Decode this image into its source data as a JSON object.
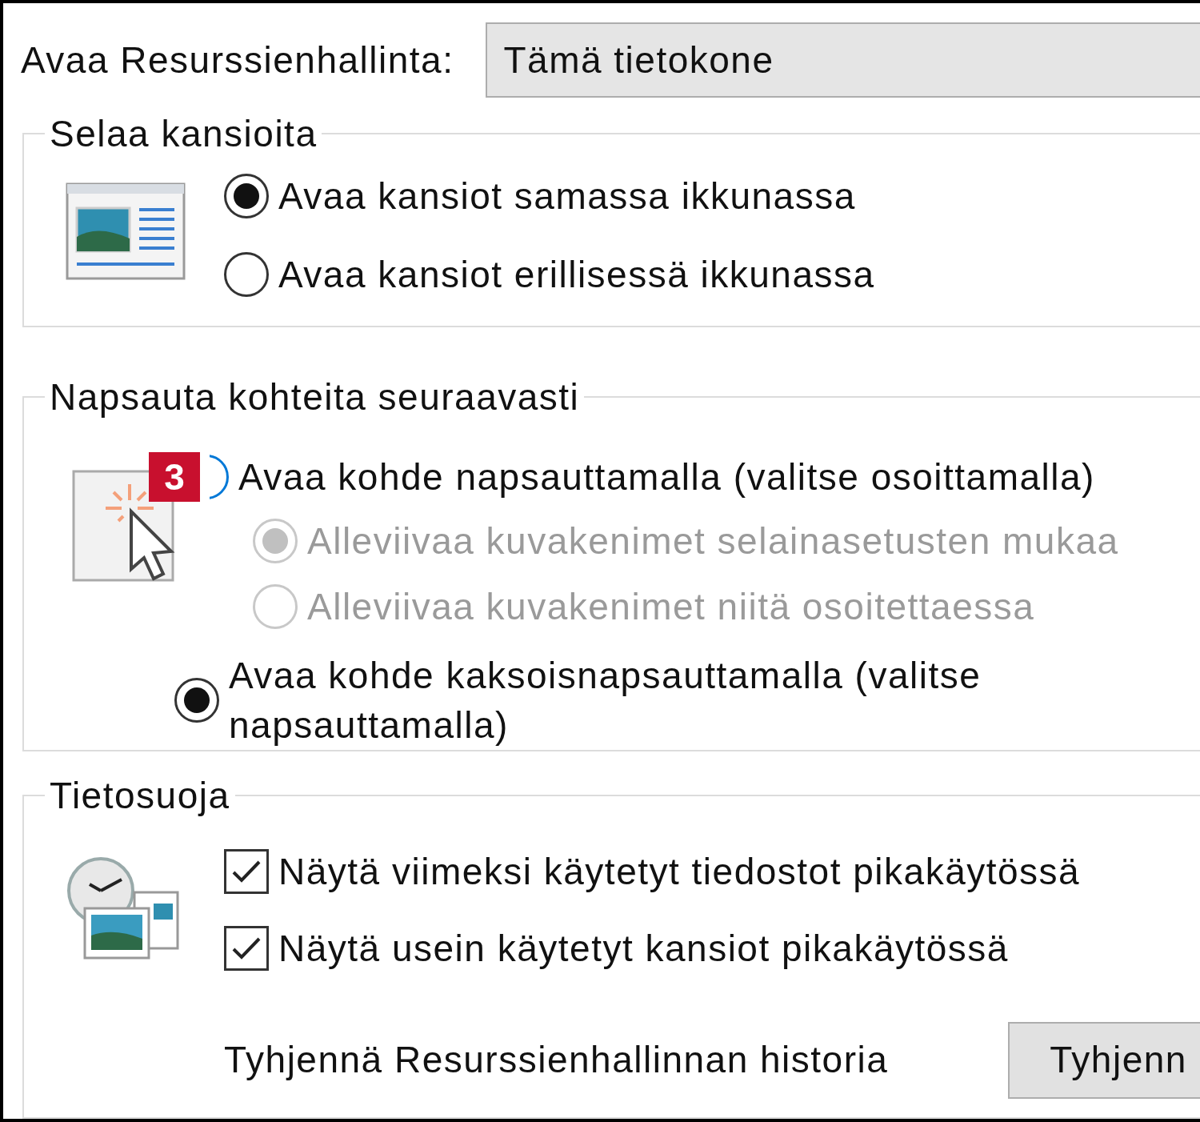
{
  "open_explorer": {
    "label": "Avaa Resurssienhallinta:",
    "value": "Tämä tietokone"
  },
  "browse_folders": {
    "title": "Selaa kansioita",
    "options": [
      {
        "label": "Avaa kansiot samassa ikkunassa",
        "selected": true
      },
      {
        "label": "Avaa kansiot erillisessä ikkunassa",
        "selected": false
      }
    ]
  },
  "click_items": {
    "title": "Napsauta kohteita seuraavasti",
    "badge": "3",
    "options": [
      {
        "label": "Avaa kohde napsauttamalla (valitse osoittamalla)",
        "selected": false,
        "focused": true,
        "children": [
          {
            "label": "Alleviivaa kuvakenimet selainasetusten mukaa",
            "selected": true,
            "disabled": true
          },
          {
            "label": "Alleviivaa kuvakenimet niitä osoitettaessa",
            "selected": false,
            "disabled": true
          }
        ]
      },
      {
        "label": "Avaa kohde kaksoisnapsauttamalla (valitse napsauttamalla)",
        "selected": true,
        "focused": false
      }
    ]
  },
  "privacy": {
    "title": "Tietosuoja",
    "options": [
      {
        "label": "Näytä viimeksi käytetyt tiedostot pikakäytössä",
        "checked": true
      },
      {
        "label": "Näytä usein käytetyt kansiot pikakäytössä",
        "checked": true
      }
    ],
    "clear_label": "Tyhjennä Resurssienhallinnan historia",
    "clear_button": "Tyhjenn"
  }
}
